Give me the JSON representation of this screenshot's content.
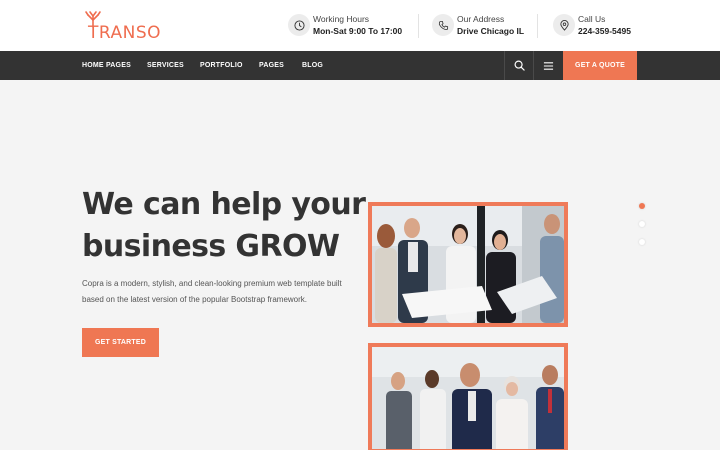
{
  "brand": {
    "logo_text": "TRANSO",
    "accent_color": "#ef7753",
    "dark_color": "#333333"
  },
  "topbar": {
    "hours": {
      "icon": "clock-icon",
      "title": "Working Hours",
      "value": "Mon-Sat 9:00 To 17:00"
    },
    "address": {
      "icon": "phone-icon",
      "title": "Our Address",
      "value": "Drive Chicago IL"
    },
    "call": {
      "icon": "location-pin-icon",
      "title": "Call Us",
      "value": "224-359-5495"
    }
  },
  "nav": {
    "items": [
      "HOME PAGES",
      "SERVICES",
      "PORTFOLIO",
      "PAGES",
      "BLOG"
    ],
    "search_icon": "search-icon",
    "menu_icon": "menu-icon",
    "quote_label": "GET A QUOTE"
  },
  "hero": {
    "title_line1": "We can help your",
    "title_line2": "business GROW",
    "description": "Copra is a modern, stylish, and clean-looking premium web template built based on the latest version of the popular Bootstrap framework.",
    "cta_label": "GET STARTED"
  },
  "slider": {
    "dot_count": 3,
    "active_index": 0
  }
}
